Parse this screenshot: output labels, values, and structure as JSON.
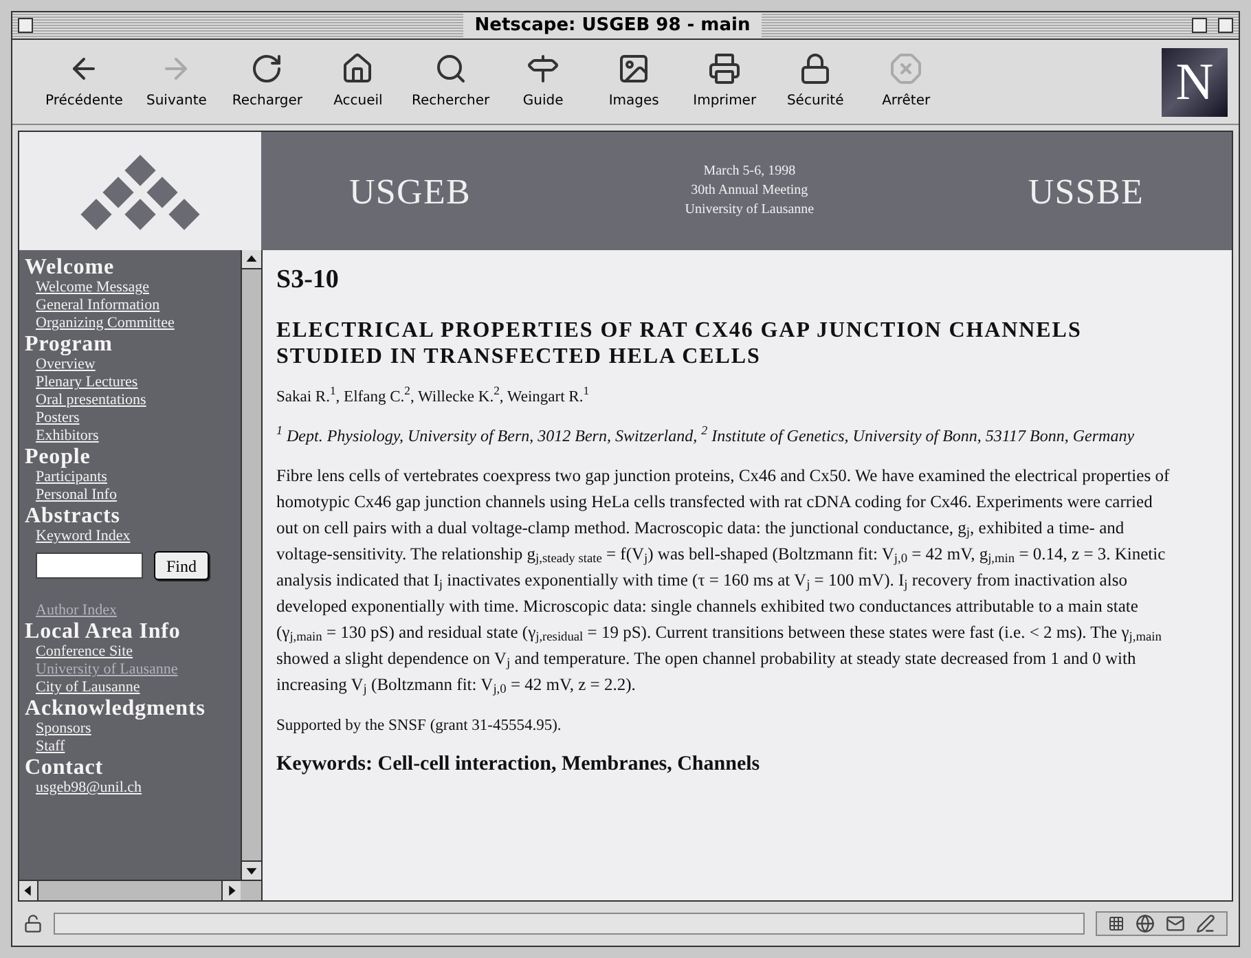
{
  "window": {
    "title": "Netscape: USGEB 98 - main"
  },
  "toolbar": [
    {
      "label": "Précédente",
      "disabled": false
    },
    {
      "label": "Suivante",
      "disabled": true
    },
    {
      "label": "Recharger",
      "disabled": false
    },
    {
      "label": "Accueil",
      "disabled": false
    },
    {
      "label": "Rechercher",
      "disabled": false
    },
    {
      "label": "Guide",
      "disabled": false
    },
    {
      "label": "Images",
      "disabled": false
    },
    {
      "label": "Imprimer",
      "disabled": false
    },
    {
      "label": "Sécurité",
      "disabled": false
    },
    {
      "label": "Arrêter",
      "disabled": true
    }
  ],
  "logo": {
    "letter": "N"
  },
  "banner": {
    "left": "USGEB",
    "date": "March 5-6, 1998",
    "meeting": "30th Annual Meeting",
    "place": "University of Lausanne",
    "right": "USSBE"
  },
  "sidebar": [
    {
      "heading": "Welcome",
      "items": [
        {
          "kind": "link",
          "label": "Welcome Message",
          "visited": false
        },
        {
          "kind": "link",
          "label": "General Information",
          "visited": false
        },
        {
          "kind": "link",
          "label": "Organizing Committee",
          "visited": false
        }
      ]
    },
    {
      "heading": "Program",
      "items": [
        {
          "kind": "link",
          "label": "Overview",
          "visited": false
        },
        {
          "kind": "link",
          "label": "Plenary Lectures",
          "visited": false
        },
        {
          "kind": "link",
          "label": "Oral presentations",
          "visited": false
        },
        {
          "kind": "link",
          "label": "Posters",
          "visited": false
        },
        {
          "kind": "link",
          "label": "Exhibitors",
          "visited": false
        }
      ]
    },
    {
      "heading": "People",
      "items": [
        {
          "kind": "link",
          "label": "Participants",
          "visited": false
        },
        {
          "kind": "link",
          "label": "Personal Info",
          "visited": false
        }
      ]
    },
    {
      "heading": "Abstracts",
      "items": [
        {
          "kind": "link",
          "label": "Keyword Index",
          "visited": false
        },
        {
          "kind": "search",
          "button": "Find"
        },
        {
          "kind": "link",
          "label": "Author Index",
          "visited": true
        }
      ]
    },
    {
      "heading": "Local Area Info",
      "items": [
        {
          "kind": "link",
          "label": "Conference Site",
          "visited": false
        },
        {
          "kind": "link",
          "label": "University of Lausanne",
          "visited": true
        },
        {
          "kind": "link",
          "label": "City of Lausanne",
          "visited": false
        }
      ]
    },
    {
      "heading": "Acknowledgments",
      "items": [
        {
          "kind": "link",
          "label": "Sponsors",
          "visited": false
        },
        {
          "kind": "link",
          "label": "Staff",
          "visited": false
        }
      ]
    },
    {
      "heading": "Contact",
      "items": [
        {
          "kind": "link",
          "label": "usgeb98@unil.ch",
          "visited": false
        }
      ]
    }
  ],
  "article": {
    "code": "S3-10",
    "title": "ELECTRICAL PROPERTIES OF RAT CX46 GAP JUNCTION CHANNELS STUDIED IN TRANSFECTED HELA CELLS",
    "authors": "Sakai R.$^{1}$, Elfang C.$^{2}$, Willecke K.$^{2}$, Weingart R.$^{1}$",
    "affiliations": "$^{1}$ Dept. Physiology, University of Bern, 3012 Bern, Switzerland,  $^{2}$ Institute of Genetics, University of Bonn, 53117 Bonn, Germany",
    "body": "Fibre lens cells of vertebrates coexpress two gap junction proteins, Cx46 and Cx50. We have examined the electrical properties of homotypic Cx46 gap junction channels using HeLa cells transfected with rat cDNA coding for Cx46. Experiments were carried out on cell pairs with a dual voltage-clamp method. Macroscopic data: the junctional conductance, g$_{j}$, exhibited a time- and voltage-sensitivity. The relationship g$_{j,steady state}$ = f(V$_{j}$) was bell-shaped (Boltzmann fit: V$_{j,0}$ = 42 mV, g$_{j,min}$ = 0.14, z = 3. Kinetic analysis indicated that I$_{j}$ inactivates exponentially with time (τ = 160 ms at V$_{j}$ = 100 mV). I$_{j}$ recovery from inactivation also developed exponentially with time. Microscopic data: single channels exhibited two conductances attributable to a main state (γ$_{j,main}$ = 130 pS) and residual state (γ$_{j,residual}$ = 19 pS). Current transitions between these states were fast (i.e. < 2 ms). The γ$_{j,main}$ showed a slight dependence on V$_{j}$ and temperature. The open channel probability at steady state decreased from 1 and 0 with increasing V$_{j}$ (Boltzmann fit: V$_{j,0}$ = 42 mV, z = 2.2).",
    "support": "Supported by the SNSF (grant 31-45554.95).",
    "keywords": "Keywords: Cell-cell interaction, Membranes, Channels"
  }
}
